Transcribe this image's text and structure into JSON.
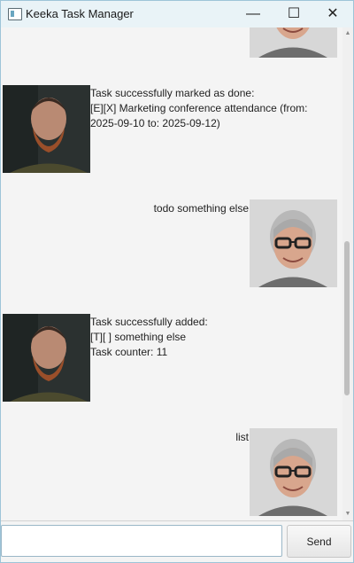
{
  "window": {
    "title": "Keeka Task Manager",
    "minimize_glyph": "—",
    "maximize_glyph": "☐",
    "close_glyph": "✕",
    "icon": "app-window-icon"
  },
  "chat": {
    "messages": [
      {
        "sender": "user",
        "text": "",
        "avatar": "older-man-glasses-avatar"
      },
      {
        "sender": "bot",
        "text": "Task successfully marked as done:\n[E][X] Marketing conference attendance (from:\n2025-09-10 to: 2025-09-12)",
        "avatar": "bearded-man-avatar"
      },
      {
        "sender": "user",
        "text": "todo something else",
        "avatar": "older-man-glasses-avatar"
      },
      {
        "sender": "bot",
        "text": "Task successfully added:\n[T][ ] something else\nTask counter: 11",
        "avatar": "bearded-man-avatar"
      },
      {
        "sender": "user",
        "text": "list",
        "avatar": "older-man-glasses-avatar"
      }
    ]
  },
  "input": {
    "value": "",
    "placeholder": ""
  },
  "send_button": {
    "label": "Send"
  },
  "scrollbar": {
    "up_glyph": "▲",
    "down_glyph": "▼"
  },
  "colors": {
    "titlebar": "#e9f3f7",
    "window_border": "#9ec4d8",
    "background": "#f4f4f4"
  }
}
